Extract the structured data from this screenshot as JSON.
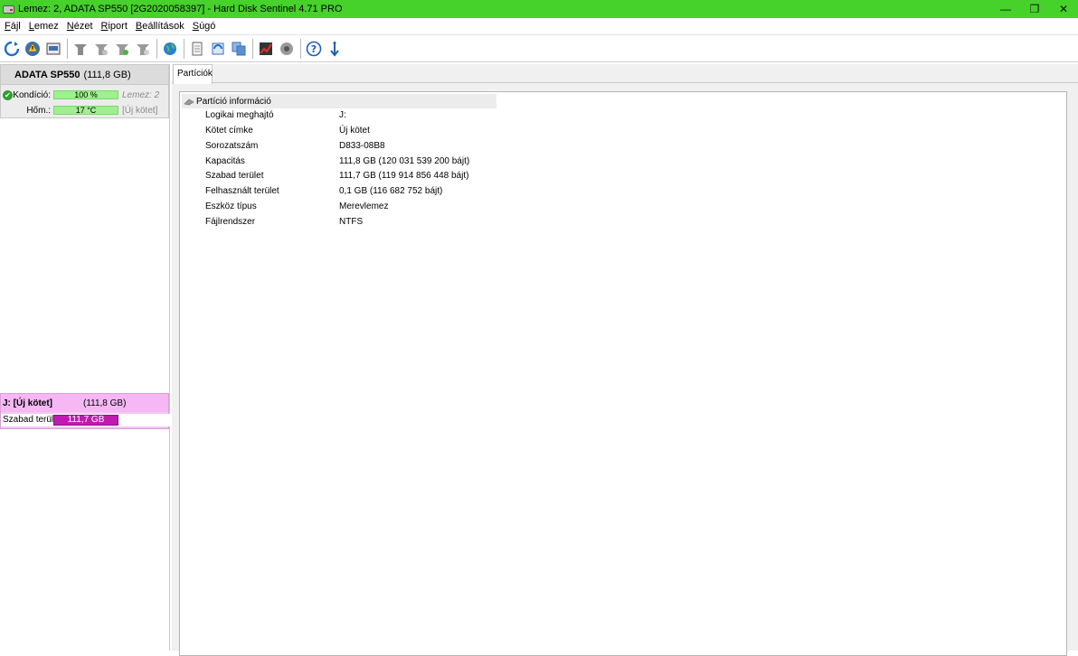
{
  "window": {
    "title": "Lemez: 2, ADATA SP550 [2G2020058397]  -  Hard Disk Sentinel 4.71 PRO",
    "controls": {
      "minimize": "—",
      "restore": "❐",
      "close": "✕"
    }
  },
  "menu": {
    "items": [
      "Fájl",
      "Lemez",
      "Nézet",
      "Riport",
      "Beállítások",
      "Súgó"
    ]
  },
  "toolbar": {
    "icons": [
      "refresh-icon",
      "warning-icon",
      "disk-report-icon",
      "test-icon",
      "surface-test-icon",
      "short-test-icon",
      "extended-test-icon",
      "globe-icon",
      "document-icon",
      "cycle-icon",
      "clone-icon",
      "graph-icon",
      "sound-icon",
      "help-icon",
      "info-icon"
    ]
  },
  "left": {
    "disk": {
      "name": "ADATA SP550",
      "size": "(111,8 GB)",
      "condition_label": "Kondíció:",
      "condition_value": "100 %",
      "condition_extra": "Lemez: 2",
      "temp_label": "Hőm.:",
      "temp_value": "17 °C",
      "temp_extra": "[Új kötet]"
    },
    "partition": {
      "letter": "J: [Új kötet]",
      "size": "(111,8 GB)",
      "free_label": "Szabad terület",
      "free_value": "111,7 GB"
    }
  },
  "right": {
    "tab": "Partíciók",
    "section_title": "Partíció információ",
    "rows": [
      {
        "key": "Logikai meghajtó",
        "value": "J:"
      },
      {
        "key": "Kötet címke",
        "value": "Új kötet"
      },
      {
        "key": "Sorozatszám",
        "value": "D833-08B8"
      },
      {
        "key": "Kapacitás",
        "value": "111,8 GB (120 031 539 200 bájt)"
      },
      {
        "key": "Szabad terület",
        "value": "111,7 GB (119 914 856 448 bájt)"
      },
      {
        "key": "Felhasznált terület",
        "value": "0,1 GB (116 682 752 bájt)"
      },
      {
        "key": "Eszköz típus",
        "value": "Merevlemez"
      },
      {
        "key": "Fájlrendszer",
        "value": "NTFS"
      }
    ]
  },
  "colors": {
    "titlebar": "#46d12b",
    "health_bar": "#9ff08f",
    "partition_bar": "#c01bb0",
    "partition_card": "#f5b8f5"
  }
}
